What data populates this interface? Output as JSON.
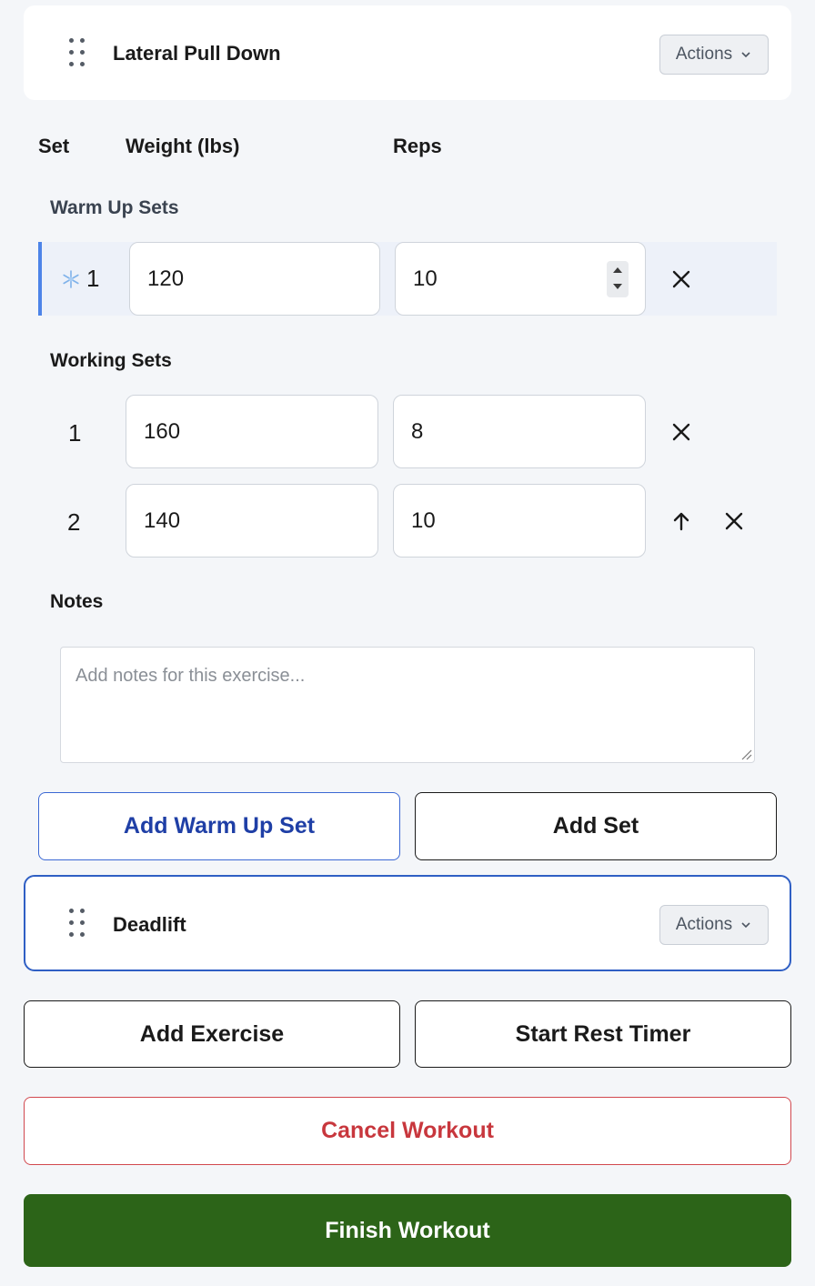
{
  "exercises": [
    {
      "name": "Lateral Pull Down",
      "actions_label": "Actions"
    },
    {
      "name": "Deadlift",
      "actions_label": "Actions"
    }
  ],
  "table_headers": {
    "set": "Set",
    "weight": "Weight (lbs)",
    "reps": "Reps"
  },
  "warmup": {
    "label": "Warm Up Sets",
    "sets": [
      {
        "num": "1",
        "weight": "120",
        "reps": "10",
        "icon": "snowflake-icon"
      }
    ]
  },
  "working": {
    "label": "Working Sets",
    "sets": [
      {
        "num": "1",
        "weight": "160",
        "reps": "8"
      },
      {
        "num": "2",
        "weight": "140",
        "reps": "10"
      }
    ]
  },
  "notes": {
    "label": "Notes",
    "placeholder": "Add notes for this exercise..."
  },
  "buttons": {
    "add_warmup": "Add Warm Up Set",
    "add_set": "Add Set",
    "add_exercise": "Add Exercise",
    "start_rest_timer": "Start Rest Timer",
    "cancel_workout": "Cancel Workout",
    "finish_workout": "Finish Workout"
  },
  "colors": {
    "accent_blue": "#4d84e8",
    "cancel_red": "#c8373d",
    "finish_green": "#2c6418"
  }
}
